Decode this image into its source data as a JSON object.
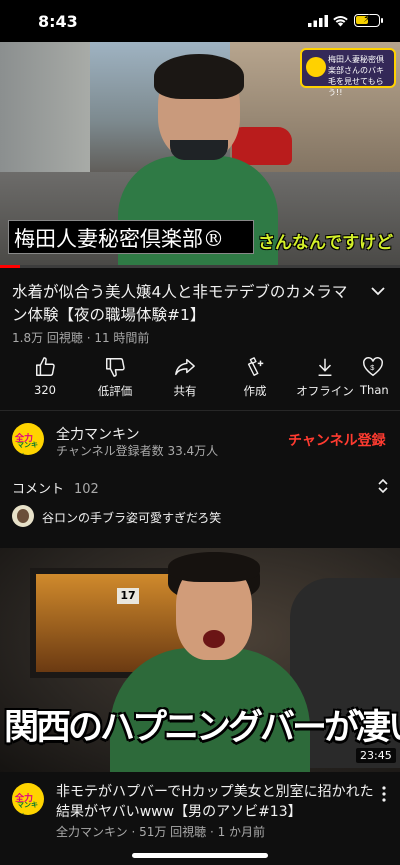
{
  "status_bar": {
    "time": "8:43"
  },
  "player": {
    "caption_main": "梅田人妻秘密倶楽部®",
    "caption_sub": "さんなんですけど",
    "corner_text": "梅田人妻秘密倶楽部さんのバキ毛を見せてもらう!!",
    "progress": 0.05
  },
  "video": {
    "title": "水着が似合う美人嬢4人と非モテデブのカメラマン体験【夜の職場体験#1】",
    "meta": "1.8万 回視聴 · 11 時間前"
  },
  "actions": [
    {
      "name": "like-button",
      "icon": "thumbs-up-icon",
      "label": "320"
    },
    {
      "name": "dislike-button",
      "icon": "thumbs-down-icon",
      "label": "低評価"
    },
    {
      "name": "share-button",
      "icon": "share-icon",
      "label": "共有"
    },
    {
      "name": "create-button",
      "icon": "create-icon",
      "label": "作成"
    },
    {
      "name": "offline-button",
      "icon": "download-icon",
      "label": "オフライン"
    },
    {
      "name": "thanks-button",
      "icon": "thanks-icon",
      "label": "Than"
    }
  ],
  "channel": {
    "name": "全力マンキン",
    "subscribers": "チャンネル登録者数 33.4万人",
    "subscribe_label": "チャンネル登録",
    "avatar_text_1": "全力",
    "avatar_text_2": "マンキン"
  },
  "comments": {
    "header": "コメント",
    "count": "102",
    "top_comment": "谷ロンの手ブラ姿可愛すぎだろ笑"
  },
  "next_video": {
    "thumbnail_text": "関西のハプニングバーが凄い",
    "sign_number": "17",
    "duration": "23:45",
    "title": "非モテがハプバーでHカップ美女と別室に招かれた結果がヤバいwww【男のアソビ#13】",
    "meta": "全力マンキン · 51万 回視聴 · 1 か月前"
  },
  "colors": {
    "accent_red": "#ff0000",
    "subscribe_red": "#ff3b30",
    "background": "#0f0f0f"
  }
}
